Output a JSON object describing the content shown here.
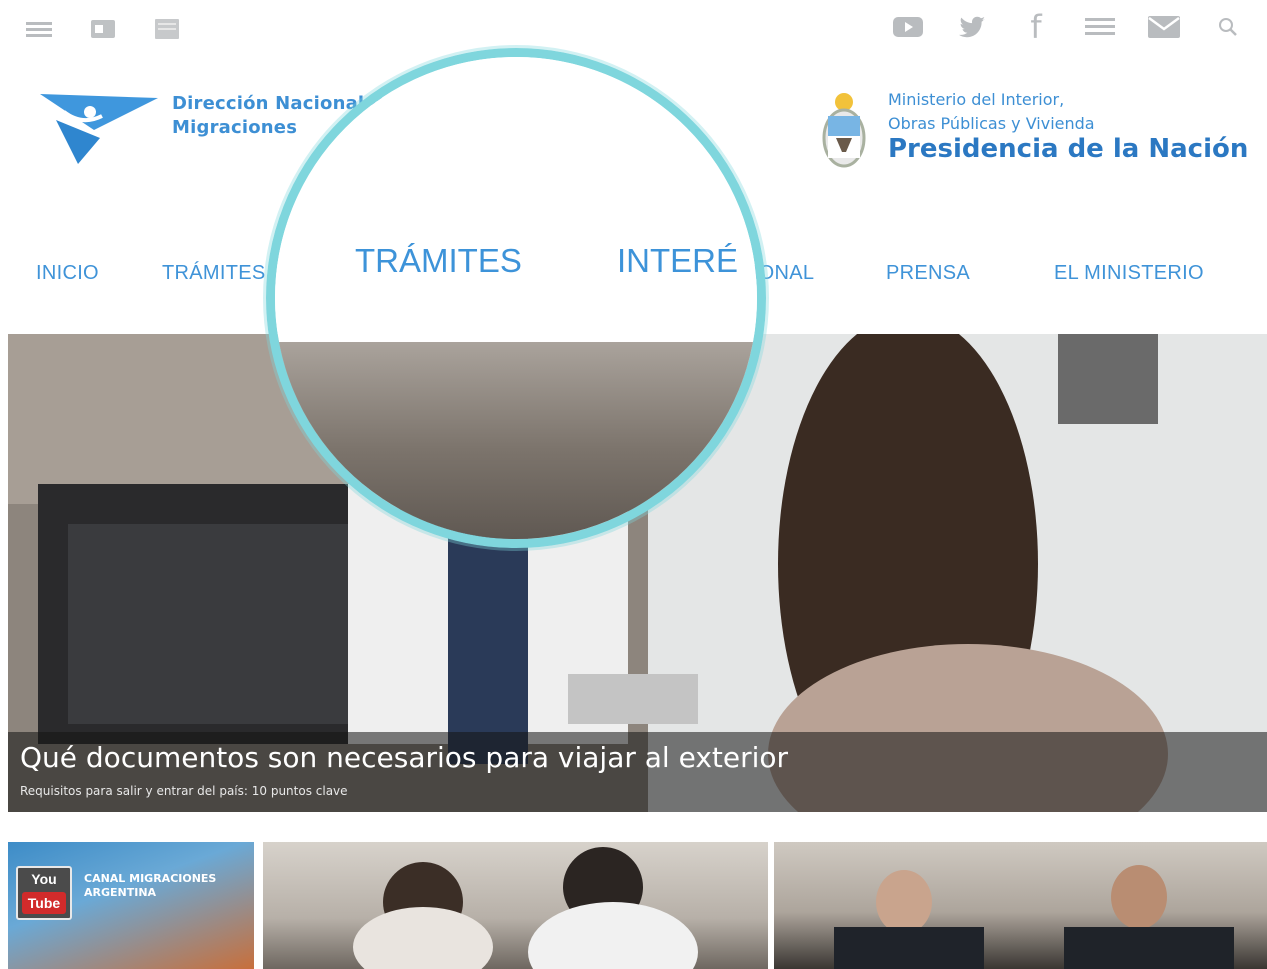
{
  "top_bar": {
    "left_icons": [
      "menu-icon",
      "id-card-icon",
      "document-icon"
    ],
    "right_icons": [
      "youtube-icon",
      "twitter-icon",
      "facebook-icon",
      "list-icon",
      "mail-icon",
      "search-icon"
    ],
    "facebook_glyph": "f"
  },
  "logos": {
    "dnm": {
      "line1": "Dirección Nacional de",
      "line2": "Migraciones"
    },
    "ministry": {
      "line1": "Ministerio del Interior,",
      "line2": "Obras Públicas y Vivienda",
      "line3": "Presidencia de la Nación"
    }
  },
  "nav": {
    "items": [
      {
        "label": "INICIO"
      },
      {
        "label": "TRÁMITES"
      },
      {
        "label": "INTERÉS GENERAL"
      },
      {
        "label": "INSTITUCIONAL"
      },
      {
        "label": "PRENSA"
      },
      {
        "label": "EL MINISTERIO"
      }
    ],
    "visible_institucional": "CIONAL"
  },
  "magnifier": {
    "item1": "TRÁMITES",
    "item2": "INTERÉ"
  },
  "hero": {
    "title": "Qué documentos son necesarios para viajar al exterior",
    "subtitle": "Requisitos para salir y entrar del país: 10 puntos clave"
  },
  "thumbnails": {
    "youtube_badge_top": "You",
    "youtube_badge_bottom": "Tube",
    "canal_line1": "CANAL MIGRACIONES",
    "canal_line2": "ARGENTINA"
  },
  "colors": {
    "accent": "#3d93d9",
    "magnifier_ring": "#7fd6dd",
    "icon_gray": "#b9bcbf"
  }
}
